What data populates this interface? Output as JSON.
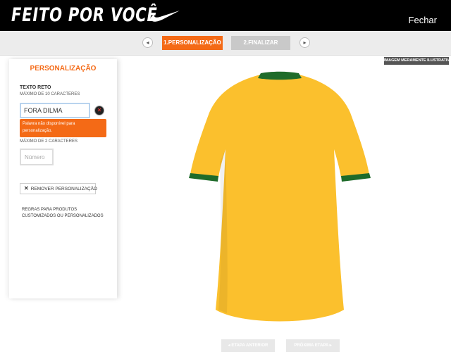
{
  "header": {
    "brand": "FEITO POR VOCÊ",
    "close_label": "Fechar"
  },
  "steps": {
    "prev_icon": "◂",
    "next_icon": "▸",
    "step1_label": "1.PERSONALIZAÇÃO",
    "step2_label": "2.FINALIZAR"
  },
  "disclaimer": "IMAGEM MERAMENTE ILUSTRATIVA",
  "panel": {
    "title": "PERSONALIZAÇÃO",
    "text_label": "TEXTO RETO",
    "text_hint": "MÁXIMO DE 10 CARACTERES",
    "text_value": "FORA DILMA",
    "clear_icon": "✕",
    "error_message": "Palavra não disponível para personalização.",
    "number_hint": "MÁXIMO DE 2 CARACTERES",
    "number_placeholder": "Número",
    "remove_icon": "✕",
    "remove_label": "REMOVER PERSONALIZAÇÃO",
    "rules_link": "REGRAS PARA PRODUTOS CUSTOMIZADOS OU PERSONALIZADOS"
  },
  "product": {
    "body_color": "#fbc02d",
    "trim_color": "#1e6b2a"
  },
  "footer": {
    "prev_label": "◂ ETAPA ANTERIOR",
    "next_label": "PRÓXIMA ETAPA ▸"
  }
}
